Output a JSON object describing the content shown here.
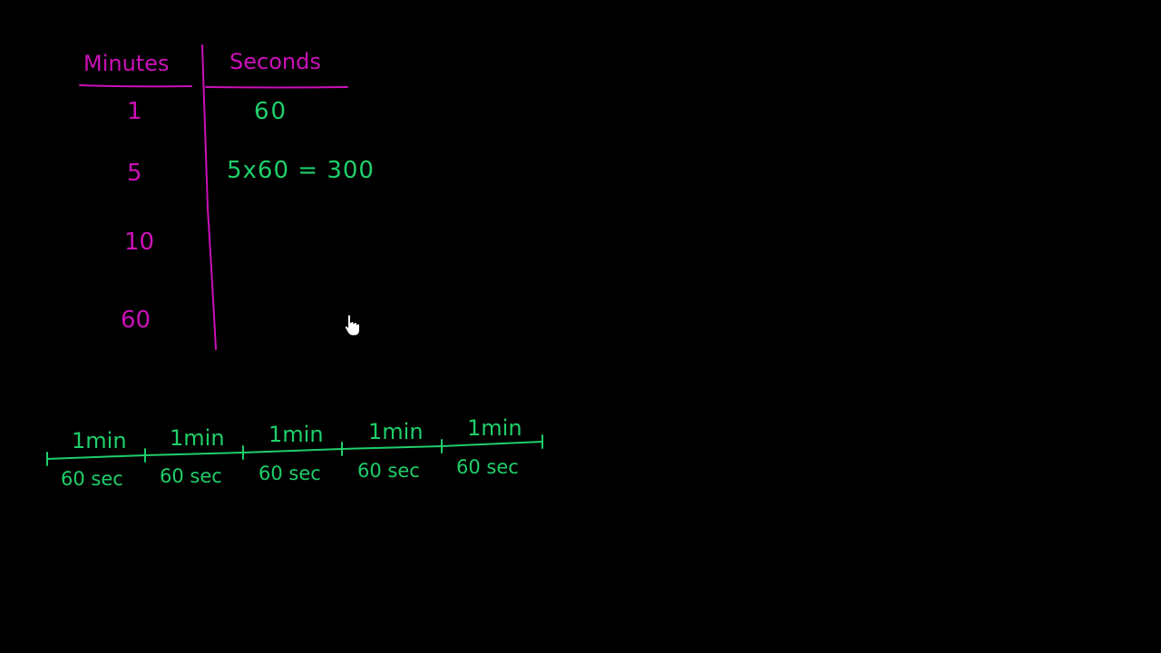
{
  "colors": {
    "background": "#000000",
    "magenta": "#cc10b8",
    "green": "#1fcf6a"
  },
  "table": {
    "header_minutes": "Minutes",
    "header_seconds": "Seconds",
    "minutes": [
      "1",
      "5",
      "10",
      "60"
    ],
    "seconds": [
      "60",
      "5x60 = 300",
      "",
      ""
    ]
  },
  "number_line": {
    "top_labels": [
      "1min",
      "1min",
      "1min",
      "1min",
      "1min"
    ],
    "bottom_labels": [
      "60 sec",
      "60 sec",
      "60 sec",
      "60 sec",
      "60 sec"
    ]
  },
  "cursor": {
    "icon": "hand-pointer-icon"
  }
}
